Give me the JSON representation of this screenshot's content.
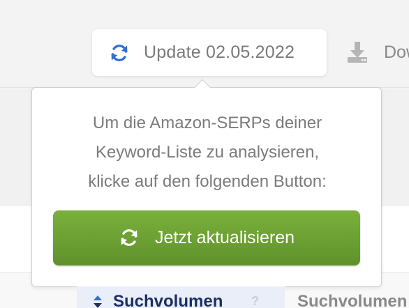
{
  "toolbar": {
    "update_label": "Update 02.05.2022",
    "download_label": "Dow",
    "refresh_icon": "refresh-icon",
    "download_icon": "download-icon"
  },
  "popover": {
    "message_lines": [
      "Um die Amazon-SERPs deiner",
      "Keyword-Liste zu analysieren,",
      "klicke auf den folgenden Button:"
    ],
    "button_label": "Jetzt aktualisieren"
  },
  "table": {
    "headers": [
      {
        "label": "Suchvolumen",
        "help": "?",
        "sorted": true
      },
      {
        "label": "Suchvolumen"
      }
    ]
  },
  "colors": {
    "accent_blue": "#2f6fd1",
    "button_green_top": "#7ab13c",
    "button_green_bottom": "#5f912b",
    "header_text": "#1c2f63"
  }
}
